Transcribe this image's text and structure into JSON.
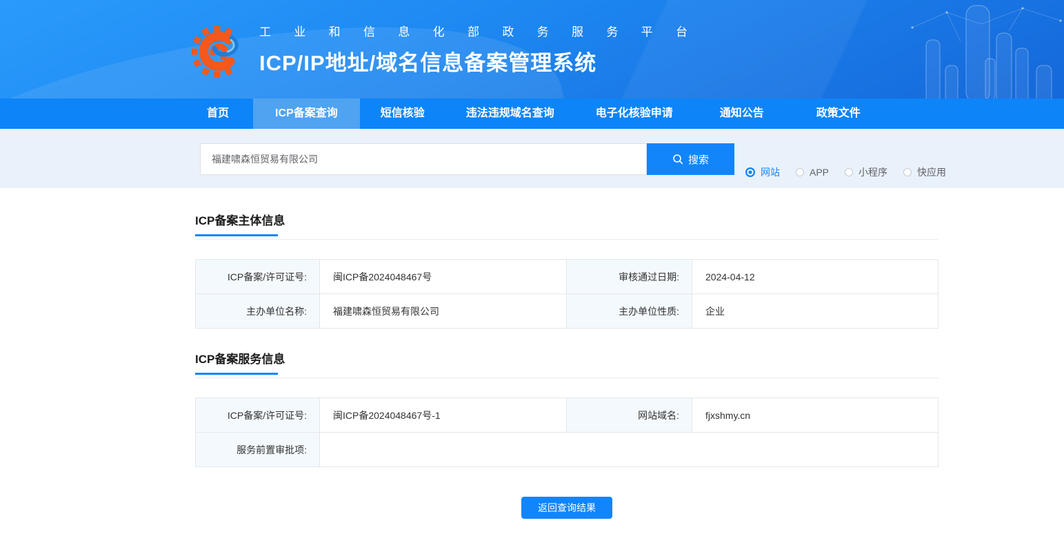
{
  "header": {
    "platform_title": "工业和信息化部政务服务平台",
    "system_title": "ICP/IP地址/域名信息备案管理系统"
  },
  "nav": {
    "items": [
      {
        "label": "首页",
        "active": false
      },
      {
        "label": "ICP备案查询",
        "active": true
      },
      {
        "label": "短信核验",
        "active": false
      },
      {
        "label": "违法违规域名查询",
        "active": false
      },
      {
        "label": "电子化核验申请",
        "active": false
      },
      {
        "label": "通知公告",
        "active": false
      },
      {
        "label": "政策文件",
        "active": false
      }
    ]
  },
  "search": {
    "input_value": "福建啸森恒贸易有限公司",
    "button_label": "搜索",
    "options": [
      {
        "label": "网站",
        "selected": true
      },
      {
        "label": "APP",
        "selected": false
      },
      {
        "label": "小程序",
        "selected": false
      },
      {
        "label": "快应用",
        "selected": false
      }
    ]
  },
  "subject_section": {
    "title": "ICP备案主体信息",
    "fields": [
      {
        "label": "ICP备案/许可证号:",
        "value": "闽ICP备2024048467号"
      },
      {
        "label": "审核通过日期:",
        "value": "2024-04-12"
      },
      {
        "label": "主办单位名称:",
        "value": "福建啸森恒贸易有限公司"
      },
      {
        "label": "主办单位性质:",
        "value": "企业"
      }
    ]
  },
  "service_section": {
    "title": "ICP备案服务信息",
    "fields": [
      {
        "label": "ICP备案/许可证号:",
        "value": "闽ICP备2024048467号-1"
      },
      {
        "label": "网站域名:",
        "value": "fjxshmy.cn"
      },
      {
        "label": "服务前置审批项:",
        "value": ""
      }
    ]
  },
  "actions": {
    "back_button_label": "返回查询结果"
  },
  "icons": {
    "logo": "miit-beian-logo",
    "search_button_icon": "magnifier"
  },
  "colors": {
    "primary": "#1285fb",
    "nav_background": "#0d84f8",
    "nav_active_background": "#4fa3f1",
    "search_section_background": "#e9f2fb",
    "table_label_background": "#f4f9fd",
    "table_border": "#e4e7ea",
    "logo_orange": "#f4581c",
    "logo_blue": "#1f7fd8"
  }
}
